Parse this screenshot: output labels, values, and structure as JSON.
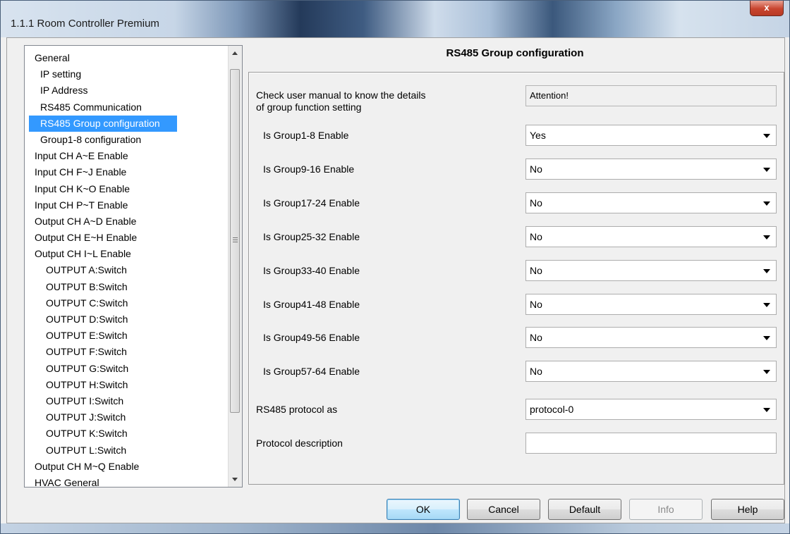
{
  "window": {
    "title": "1.1.1 Room Controller Premium",
    "close_label": "x"
  },
  "tree": {
    "items": [
      {
        "label": "General",
        "level": 0,
        "selected": false
      },
      {
        "label": "IP setting",
        "level": 1,
        "selected": false
      },
      {
        "label": "IP Address",
        "level": 1,
        "selected": false
      },
      {
        "label": "RS485 Communication",
        "level": 1,
        "selected": false
      },
      {
        "label": "RS485 Group configuration",
        "level": 1,
        "selected": true
      },
      {
        "label": "Group1-8 configuration",
        "level": 1,
        "selected": false
      },
      {
        "label": "Input CH A~E Enable",
        "level": 0,
        "selected": false
      },
      {
        "label": "Input CH F~J Enable",
        "level": 0,
        "selected": false
      },
      {
        "label": "Input CH K~O Enable",
        "level": 0,
        "selected": false
      },
      {
        "label": "Input CH P~T Enable",
        "level": 0,
        "selected": false
      },
      {
        "label": "Output CH A~D Enable",
        "level": 0,
        "selected": false
      },
      {
        "label": "Output CH E~H Enable",
        "level": 0,
        "selected": false
      },
      {
        "label": "Output CH I~L Enable",
        "level": 0,
        "selected": false
      },
      {
        "label": "OUTPUT A:Switch",
        "level": 2,
        "selected": false
      },
      {
        "label": "OUTPUT B:Switch",
        "level": 2,
        "selected": false
      },
      {
        "label": "OUTPUT C:Switch",
        "level": 2,
        "selected": false
      },
      {
        "label": "OUTPUT D:Switch",
        "level": 2,
        "selected": false
      },
      {
        "label": "OUTPUT E:Switch",
        "level": 2,
        "selected": false
      },
      {
        "label": "OUTPUT F:Switch",
        "level": 2,
        "selected": false
      },
      {
        "label": "OUTPUT G:Switch",
        "level": 2,
        "selected": false
      },
      {
        "label": "OUTPUT H:Switch",
        "level": 2,
        "selected": false
      },
      {
        "label": "OUTPUT I:Switch",
        "level": 2,
        "selected": false
      },
      {
        "label": "OUTPUT J:Switch",
        "level": 2,
        "selected": false
      },
      {
        "label": "OUTPUT K:Switch",
        "level": 2,
        "selected": false
      },
      {
        "label": "OUTPUT L:Switch",
        "level": 2,
        "selected": false
      },
      {
        "label": "Output CH M~Q Enable",
        "level": 0,
        "selected": false
      },
      {
        "label": "HVAC General",
        "level": 0,
        "selected": false
      }
    ]
  },
  "panel": {
    "title": "RS485 Group configuration",
    "note_line1": "Check user manual to know the details",
    "note_line2": "of group function setting",
    "note_value": "Attention!",
    "groups": [
      {
        "label": "Is Group1-8 Enable",
        "value": "Yes"
      },
      {
        "label": "Is Group9-16 Enable",
        "value": "No"
      },
      {
        "label": "Is Group17-24 Enable",
        "value": "No"
      },
      {
        "label": "Is Group25-32 Enable",
        "value": "No"
      },
      {
        "label": "Is Group33-40 Enable",
        "value": "No"
      },
      {
        "label": "Is Group41-48 Enable",
        "value": "No"
      },
      {
        "label": "Is Group49-56 Enable",
        "value": "No"
      },
      {
        "label": "Is Group57-64 Enable",
        "value": "No"
      }
    ],
    "protocol": {
      "label": "RS485 protocol as",
      "value": "protocol-0"
    },
    "description": {
      "label": "Protocol description",
      "value": ""
    }
  },
  "buttons": {
    "ok": "OK",
    "cancel": "Cancel",
    "default": "Default",
    "info": "Info",
    "help": "Help"
  }
}
